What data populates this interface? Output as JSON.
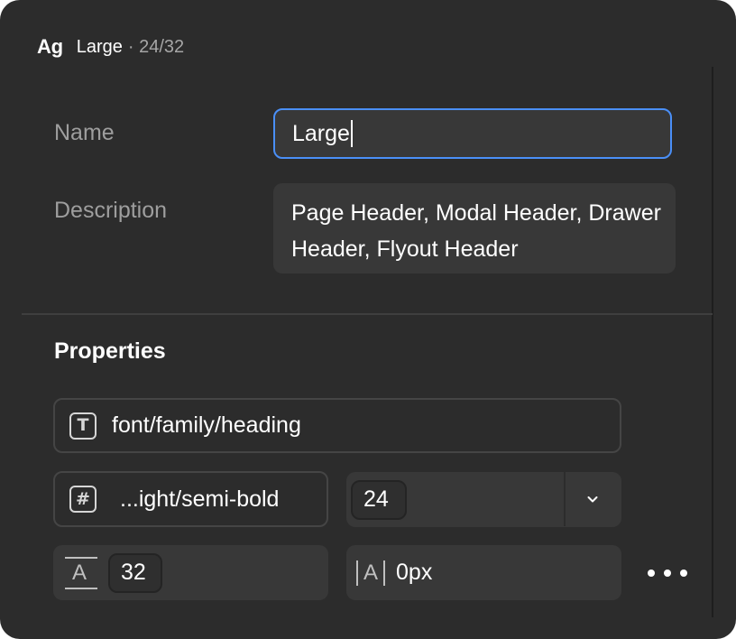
{
  "header": {
    "glyph": "Ag",
    "style_name": "Large",
    "meta": "· 24/32"
  },
  "form": {
    "name_label": "Name",
    "name_value": "Large",
    "description_label": "Description",
    "description_value": "Page Header, Modal Header, Drawer Header, Flyout Header"
  },
  "properties": {
    "title": "Properties",
    "font_family": "font/family/heading",
    "font_weight": "...ight/semi-bold",
    "font_size": "24",
    "line_height": "32",
    "letter_spacing": "0px"
  },
  "icons": {
    "font_family_icon": "text-T-icon",
    "font_weight_icon": "hash-icon",
    "size_dropdown_icon": "chevron-down-icon",
    "line_height_icon": "line-height-icon",
    "letter_spacing_icon": "letter-spacing-icon",
    "more_icon": "more-horizontal-icon"
  },
  "colors": {
    "panel_bg": "#2c2c2c",
    "focus_ring": "#4a8ff7",
    "field_bg": "#383838"
  }
}
